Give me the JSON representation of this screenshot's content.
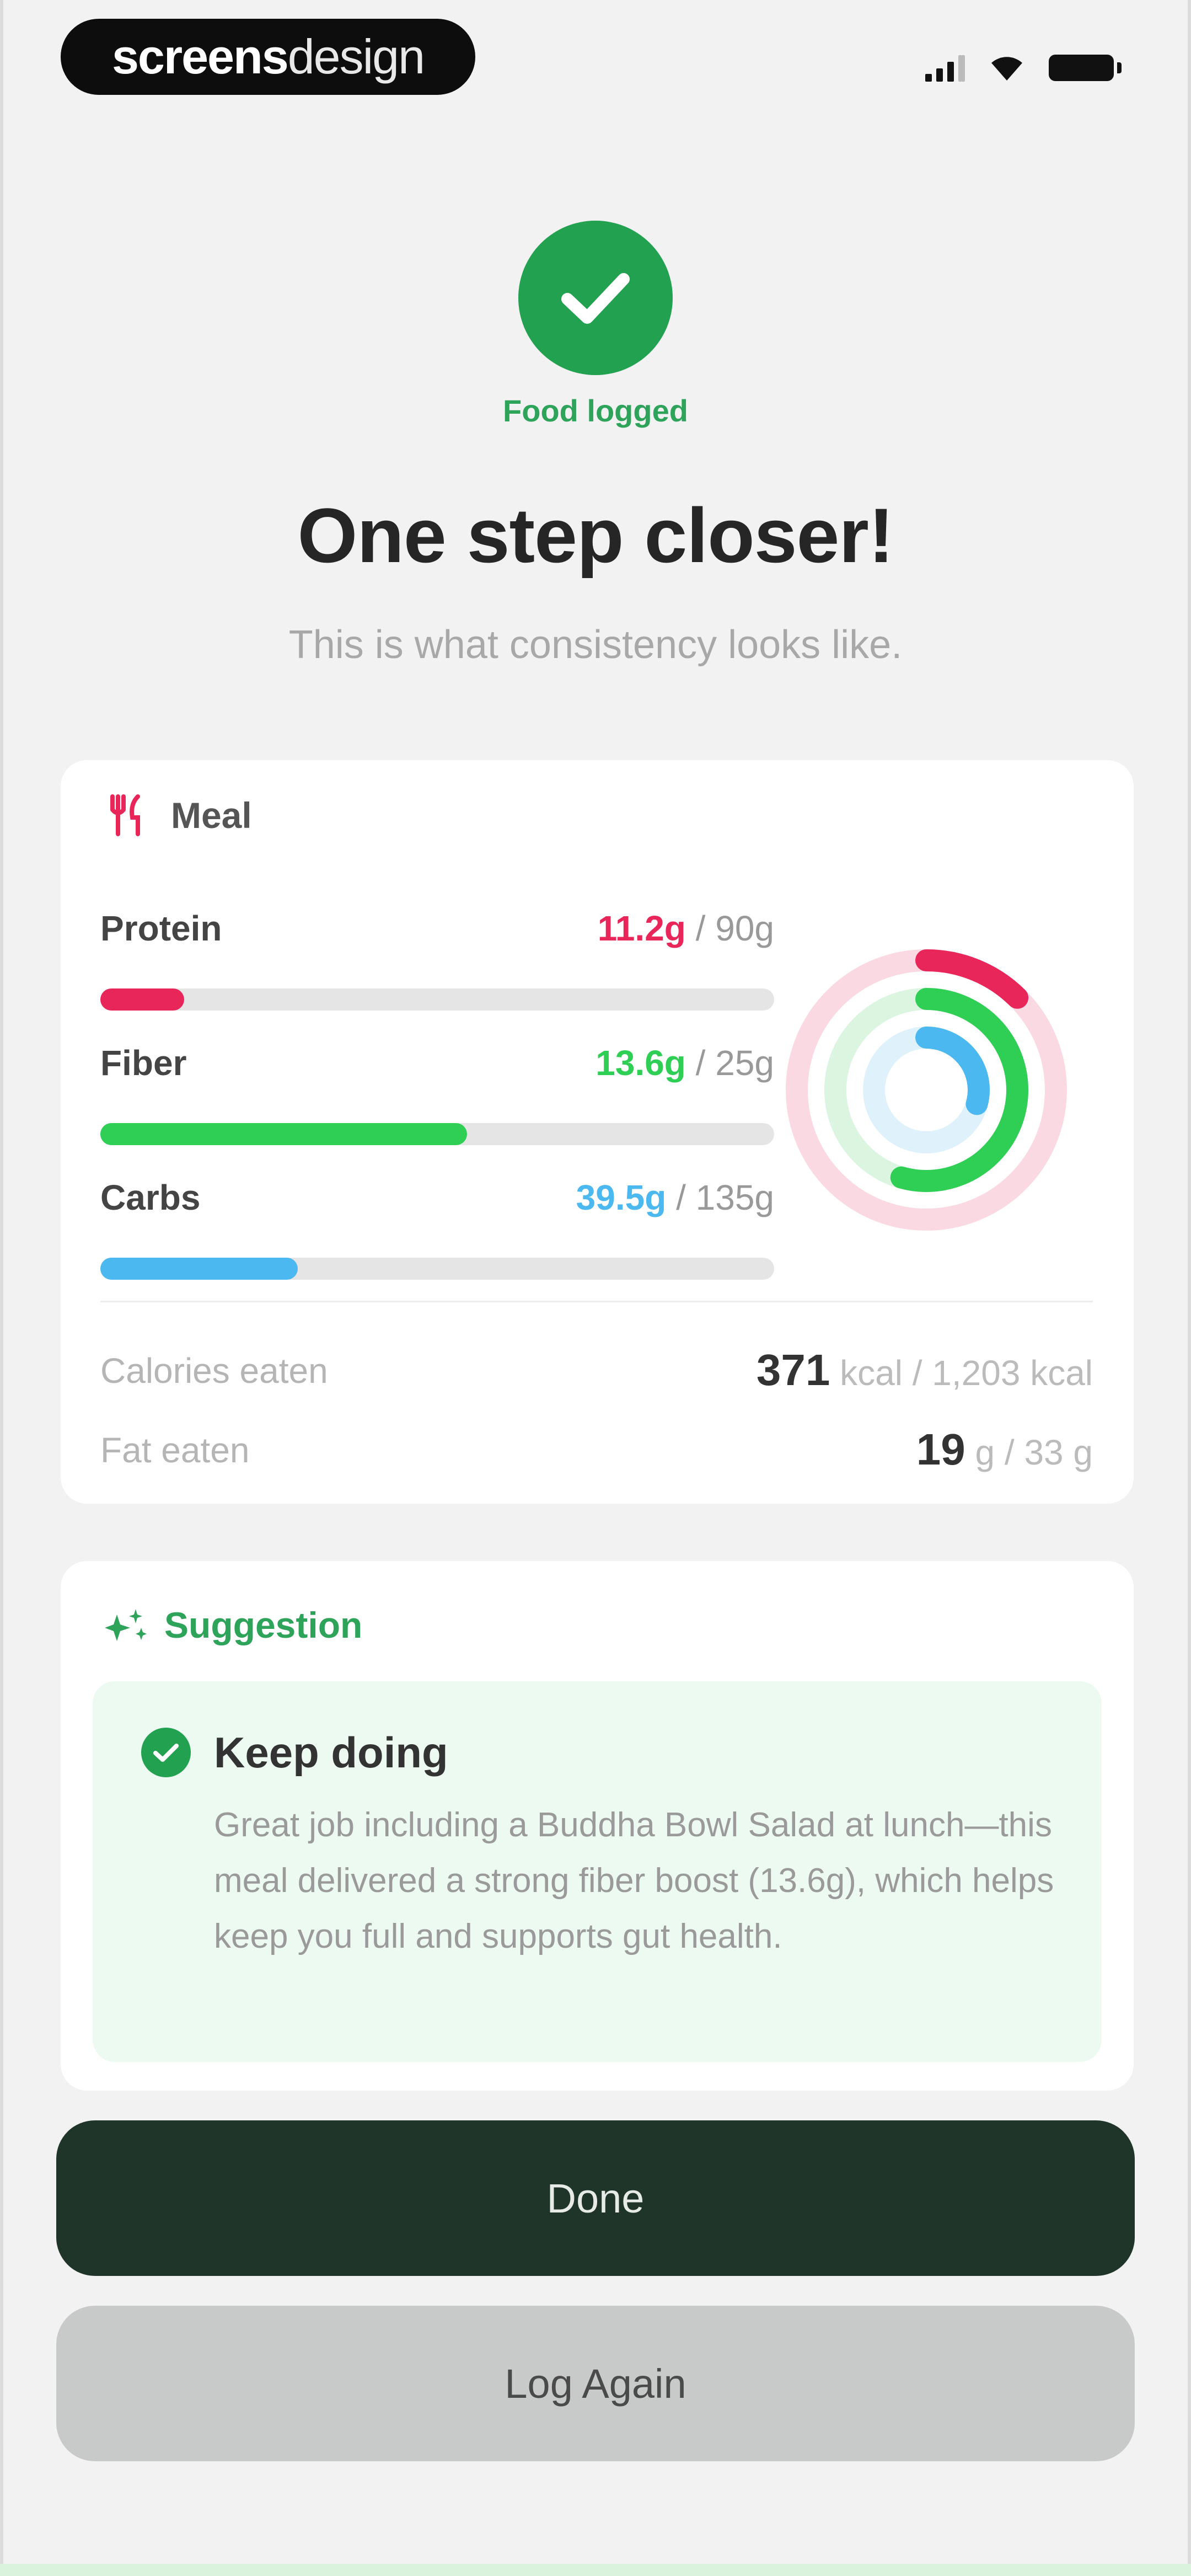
{
  "status_bar": {
    "brand_bold": "screens",
    "brand_light": "design"
  },
  "header": {
    "logged_label": "Food logged",
    "headline": "One step closer!",
    "subline": "This is what consistency looks like."
  },
  "meal": {
    "title": "Meal",
    "macros": [
      {
        "label": "Protein",
        "current": "11.2g",
        "goal": " / 90g",
        "color": "#e8265a",
        "progress": 0.124
      },
      {
        "label": "Fiber",
        "current": "13.6g",
        "goal": " / 25g",
        "color": "#2fcf55",
        "progress": 0.544
      },
      {
        "label": "Carbs",
        "current": "39.5g",
        "goal": " / 135g",
        "color": "#4cb8f0",
        "progress": 0.293
      }
    ],
    "stats": [
      {
        "label": "Calories eaten",
        "value": "371",
        "unit": " kcal / 1,203 kcal"
      },
      {
        "label": "Fat eaten",
        "value": "19",
        "unit": " g / 33 g"
      }
    ]
  },
  "suggestion": {
    "title": "Suggestion",
    "heading": "Keep doing",
    "body": "Great job including a Buddha Bowl Salad at lunch—this meal delivered a strong fiber boost (13.6g), which helps keep you full and supports gut health."
  },
  "buttons": {
    "done": "Done",
    "log_again": "Log Again"
  },
  "colors": {
    "success": "#22a150",
    "primary_button": "#1f3529",
    "secondary_button": "#c8cac9"
  }
}
